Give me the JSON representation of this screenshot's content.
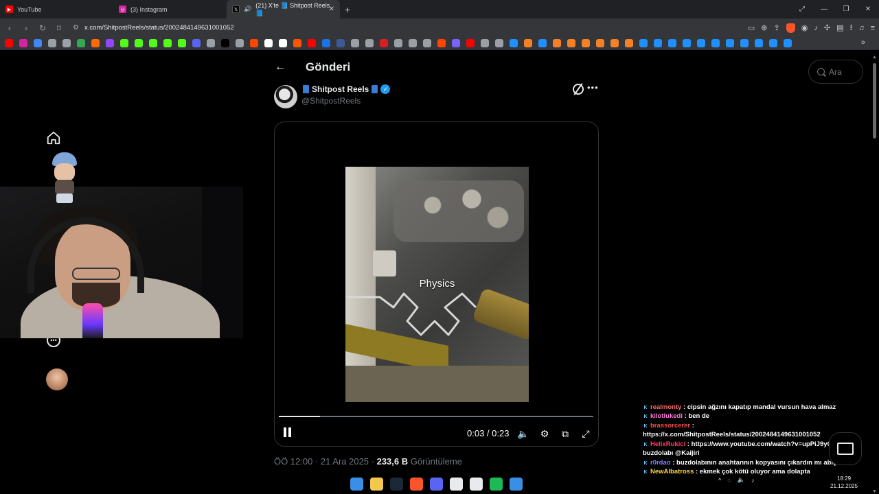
{
  "browser": {
    "tabs": [
      {
        "title": "YouTube",
        "favicon_color": "#ff0000",
        "active": false
      },
      {
        "title": "(3) Instagram",
        "favicon_color": "#d6249f",
        "active": false
      },
      {
        "title": "(21) X'te 📘 Shitpost Reels 📘",
        "favicon_color": "#000000",
        "active": true
      }
    ],
    "new_tab": "+",
    "url": "x.com/ShitpostReels/status/2002484149631001052",
    "bookmark_colors": [
      "#ff0000",
      "#d6249f",
      "#4285f4",
      "#9aa0a6",
      "#9aa0a6",
      "#34a853",
      "#ff6b00",
      "#9146ff",
      "#53fc18",
      "#53fc18",
      "#53fc18",
      "#53fc18",
      "#53fc18",
      "#5865f2",
      "#9aa0a6",
      "#000000",
      "#9aa0a6",
      "#ff4500",
      "#ffffff",
      "#ffffff",
      "#ff5500",
      "#ff0000",
      "#1a73e8",
      "#3b5998",
      "#9aa0a6",
      "#9aa0a6",
      "#d81f26",
      "#9aa0a6",
      "#9aa0a6",
      "#9aa0a6",
      "#ff4500",
      "#7b61ff",
      "#ff0000",
      "#9aa0a6",
      "#9aa0a6",
      "#1e90ff",
      "#f58025",
      "#1e90ff",
      "#f58025",
      "#f58025",
      "#f58025",
      "#f58025",
      "#f58025",
      "#f58025",
      "#1e90ff",
      "#1e90ff",
      "#1e90ff",
      "#1e90ff",
      "#1e90ff",
      "#1e90ff",
      "#1e90ff",
      "#1e90ff",
      "#1e90ff",
      "#1e90ff",
      "#1e90ff"
    ]
  },
  "post": {
    "header_title": "Gönderi",
    "author_name": "Shitpost Reels",
    "author_handle": "@ShitpostReels",
    "video": {
      "caption": "Physics",
      "time": "0:03 / 0:23",
      "progress_fraction": 0.13
    },
    "timestamp": "ÖÖ 12:00 · 21 Ara 2025 · ",
    "views_count": "233,6 B",
    "views_label": " Görüntüleme"
  },
  "search": {
    "placeholder": "Ara"
  },
  "chat": [
    {
      "user": "realmonty",
      "user_color": "#ff6b6b",
      "text": " : cipsin ağzını kapatıp mandal vursun hava almaz"
    },
    {
      "user": "kilotlukedi",
      "user_color": "#ff7ad9",
      "text": " : ben de"
    },
    {
      "user": "brassorcerer",
      "user_color": "#ff4d4d",
      "text": " :"
    },
    {
      "user": "",
      "user_color": "#ffffff",
      "text": "https://x.com/ShitpostReels/status/2002484149631001052"
    },
    {
      "user": "HelixRukici",
      "user_color": "#ff3b6b",
      "text": " : https://www.youtube.com/watch?v=upPiJ9yOYlY"
    },
    {
      "user": "",
      "user_color": "#ffffff",
      "text": "buzdolabı @Kaijiri"
    },
    {
      "user": "r0rdao",
      "user_color": "#8a7dff",
      "text": " : buzdolabının anahtarının kopyasını çıkardın mı abiş"
    },
    {
      "user": "NewAlbatross",
      "user_color": "#ffd34d",
      "text": " : ekmek çok kötü oluyor ama dolapta"
    }
  ],
  "taskbar": {
    "icon_colors": [
      "#3a8ee6",
      "#f2c94c",
      "#1b2838",
      "#fb542b",
      "#5865f2",
      "#e8eaed",
      "#e8eaed",
      "#1db954",
      "#3a8ee6"
    ],
    "clock_time": "18:29",
    "clock_date": "21.12.2025"
  }
}
